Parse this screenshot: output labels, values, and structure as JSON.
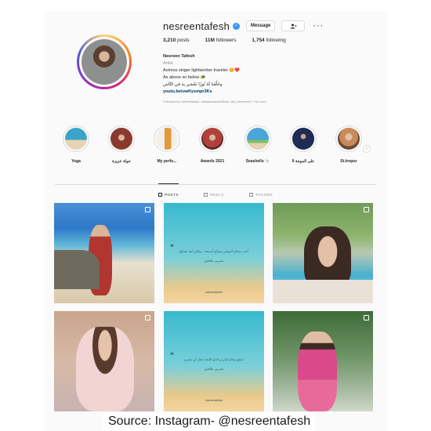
{
  "profile": {
    "username": "nesreentafesh",
    "verified_icon": "✓",
    "message_label": "Message",
    "follow_icon": "person-plus-icon",
    "more_label": "···",
    "stats": {
      "posts": "3,210",
      "posts_label": "posts",
      "followers": "11M",
      "followers_label": "followers",
      "following": "1,754",
      "following_label": "following"
    },
    "bio": {
      "name": "Nesreen Tafesh",
      "category": "Artist",
      "line1": "Actress singer lightworker traveler 😊❤️",
      "line2": "As above so below 🐢",
      "line3": "وخَلَّقَنا لَهُ نُورًا نَمْشي بِه في النّاس",
      "link": "youtu.be/uwKysmpr3Ks",
      "followed_by": "Followed by nahedelsebai, dallamubarakofficial, lala_ebraheem + 98 more"
    }
  },
  "highlights": [
    {
      "label": "Yoga",
      "color": "#3aa3c9"
    },
    {
      "label": "جولة عزيزة",
      "color": "#8a3a2d"
    },
    {
      "label": "My perfu...",
      "color": "#e09a3a"
    },
    {
      "label": "Awards 2021",
      "color": "#b2403a"
    },
    {
      "label": "Seashells 🐚",
      "color": "#4aa6d8"
    },
    {
      "label": "على الموجة 6",
      "color": "#1f2a55"
    },
    {
      "label": "St.tropez",
      "color": "#c98a5a"
    }
  ],
  "highlight_next": "›",
  "tabs": [
    {
      "label": "POSTS",
      "active": true
    },
    {
      "label": "REELS",
      "active": false
    },
    {
      "label": "TAGGED",
      "active": false
    }
  ],
  "posts": {
    "quote1": "أحب سماع أصواتي سماع أسمعه .. ولكن أمنا بشأنها",
    "author1": "نسرين طافش",
    "quote2": "شجع سلام كيان و الذي كلمات قبل أن تشرع",
    "author2": "نسرين طافش",
    "brand": "nesreentafesh"
  },
  "source_caption": "Source: Instagram- @nesreentafesh"
}
